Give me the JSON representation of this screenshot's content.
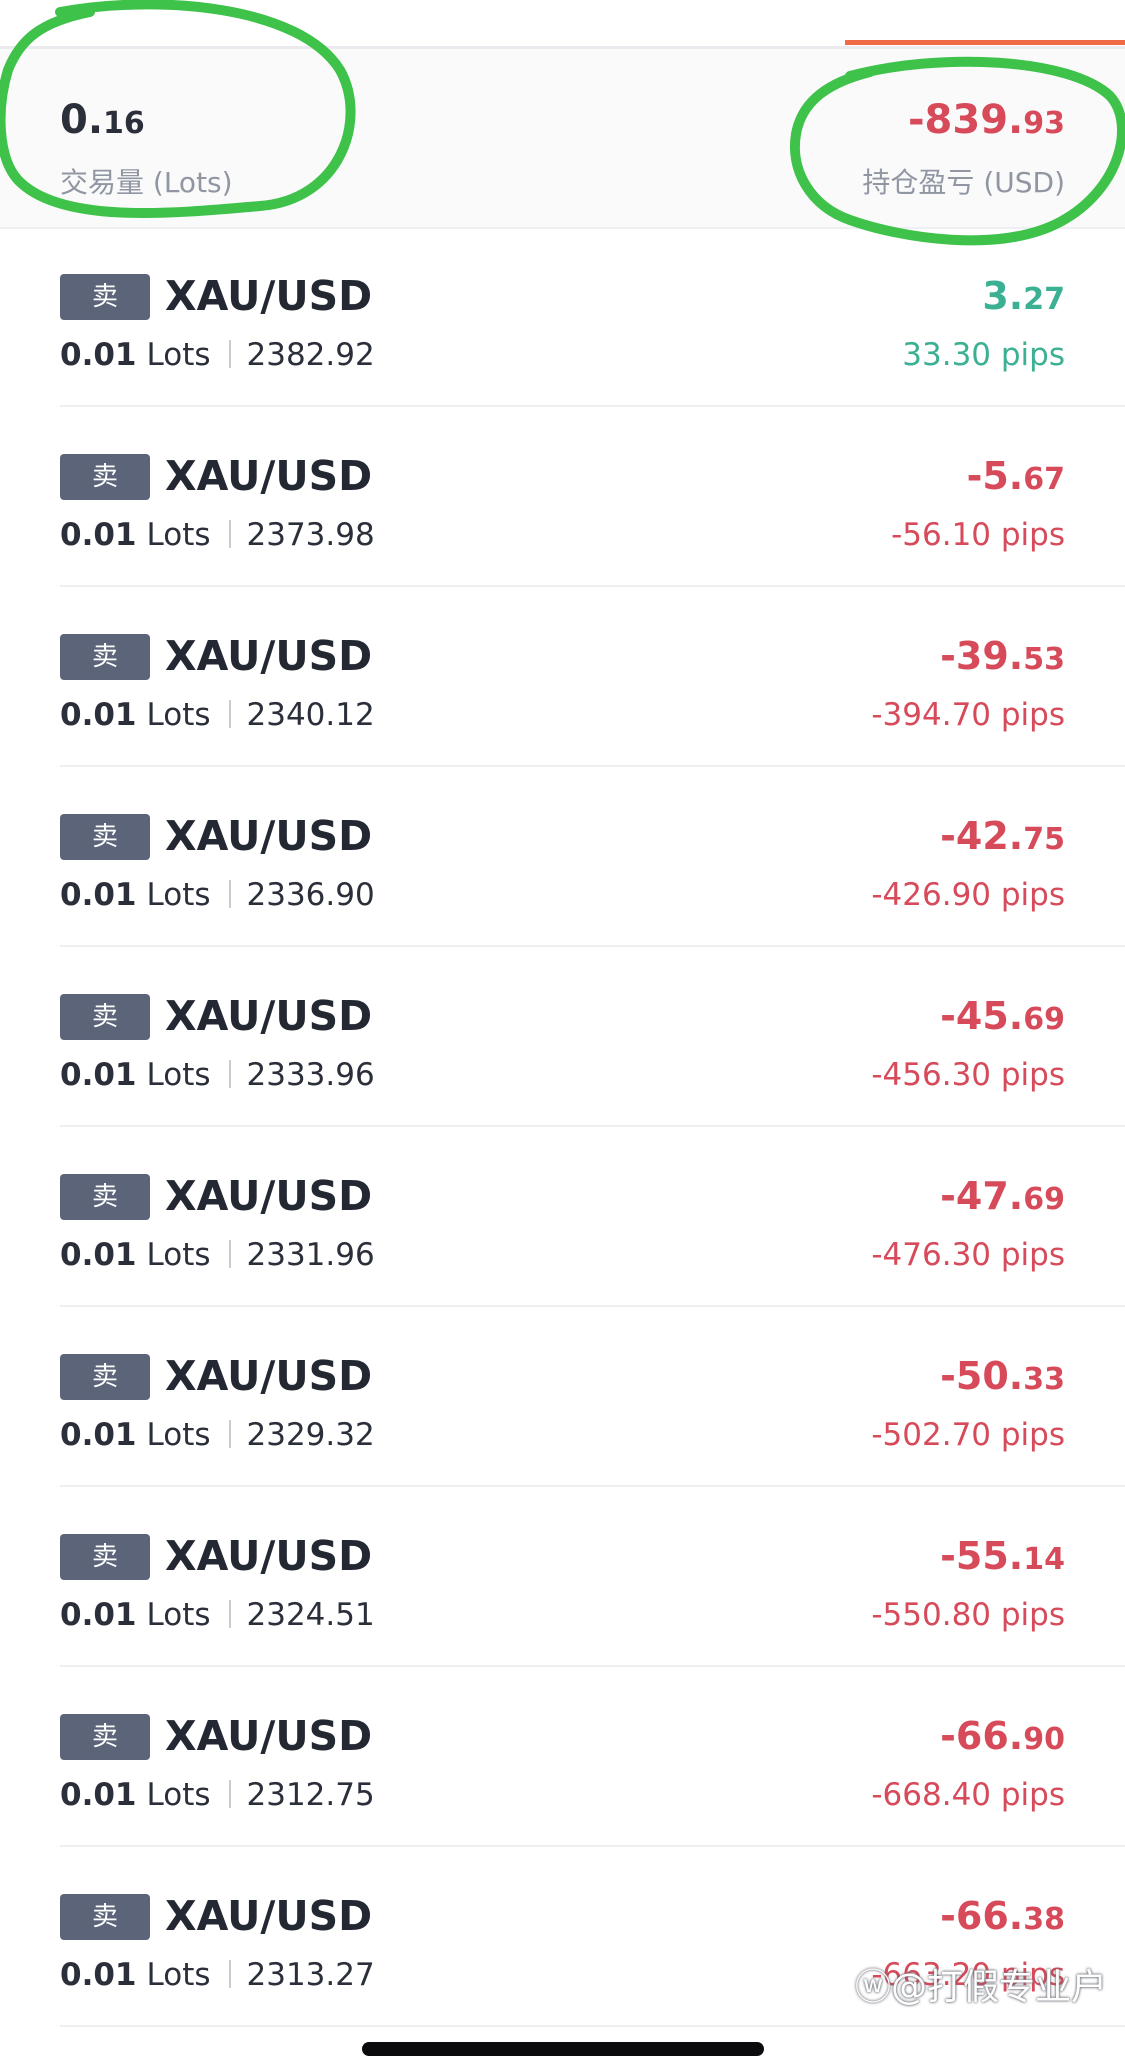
{
  "summary": {
    "volume_main": "0.",
    "volume_decimal": "16",
    "volume_label": "交易量 (Lots)",
    "pnl_main": "-839.",
    "pnl_decimal": "93",
    "pnl_label": "持仓盈亏 (USD)"
  },
  "positions": [
    {
      "side": "卖",
      "symbol": "XAU/USD",
      "lots": "0.01",
      "lots_unit": "Lots",
      "price": "2382.92",
      "pnl_main": "3.",
      "pnl_decimal": "27",
      "pips": "33.30 pips",
      "direction": "profit"
    },
    {
      "side": "卖",
      "symbol": "XAU/USD",
      "lots": "0.01",
      "lots_unit": "Lots",
      "price": "2373.98",
      "pnl_main": "-5.",
      "pnl_decimal": "67",
      "pips": "-56.10 pips",
      "direction": "loss"
    },
    {
      "side": "卖",
      "symbol": "XAU/USD",
      "lots": "0.01",
      "lots_unit": "Lots",
      "price": "2340.12",
      "pnl_main": "-39.",
      "pnl_decimal": "53",
      "pips": "-394.70 pips",
      "direction": "loss"
    },
    {
      "side": "卖",
      "symbol": "XAU/USD",
      "lots": "0.01",
      "lots_unit": "Lots",
      "price": "2336.90",
      "pnl_main": "-42.",
      "pnl_decimal": "75",
      "pips": "-426.90 pips",
      "direction": "loss"
    },
    {
      "side": "卖",
      "symbol": "XAU/USD",
      "lots": "0.01",
      "lots_unit": "Lots",
      "price": "2333.96",
      "pnl_main": "-45.",
      "pnl_decimal": "69",
      "pips": "-456.30 pips",
      "direction": "loss"
    },
    {
      "side": "卖",
      "symbol": "XAU/USD",
      "lots": "0.01",
      "lots_unit": "Lots",
      "price": "2331.96",
      "pnl_main": "-47.",
      "pnl_decimal": "69",
      "pips": "-476.30 pips",
      "direction": "loss"
    },
    {
      "side": "卖",
      "symbol": "XAU/USD",
      "lots": "0.01",
      "lots_unit": "Lots",
      "price": "2329.32",
      "pnl_main": "-50.",
      "pnl_decimal": "33",
      "pips": "-502.70 pips",
      "direction": "loss"
    },
    {
      "side": "卖",
      "symbol": "XAU/USD",
      "lots": "0.01",
      "lots_unit": "Lots",
      "price": "2324.51",
      "pnl_main": "-55.",
      "pnl_decimal": "14",
      "pips": "-550.80 pips",
      "direction": "loss"
    },
    {
      "side": "卖",
      "symbol": "XAU/USD",
      "lots": "0.01",
      "lots_unit": "Lots",
      "price": "2312.75",
      "pnl_main": "-66.",
      "pnl_decimal": "90",
      "pips": "-668.40 pips",
      "direction": "loss"
    },
    {
      "side": "卖",
      "symbol": "XAU/USD",
      "lots": "0.01",
      "lots_unit": "Lots",
      "price": "2313.27",
      "pnl_main": "-66.",
      "pnl_decimal": "38",
      "pips": "-663.20 pips",
      "direction": "loss"
    }
  ],
  "watermark": "@打假专业户",
  "colors": {
    "profit": "#3bb093",
    "loss": "#d64a5a",
    "accent": "#f06a45",
    "badge": "#5b6478",
    "annotation_marker": "#3ec24a"
  },
  "icons": {
    "watermark_logo": "weibo-logo-icon"
  }
}
